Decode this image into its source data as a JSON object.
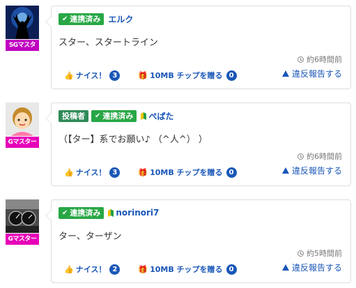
{
  "comments": [
    {
      "rank_label": "SGマスタ",
      "rank_color": "#c000c0",
      "avatar_icon": "deer-silhouette-icon",
      "tags": [
        {
          "label": "連携済み",
          "kind": "linked"
        }
      ],
      "beginner_mark": false,
      "username": "エルク",
      "text": "スター、スタートライン",
      "timestamp": "約6時間前",
      "like_label": "ナイス！",
      "like_count": "3",
      "tip_label": "10MB チップを贈る",
      "tip_count": "0",
      "report_label": "違反報告する"
    },
    {
      "rank_label": "Gマスター",
      "rank_color": "#e600b8",
      "avatar_icon": "cartoon-person-icon",
      "tags": [
        {
          "label": "投稿者",
          "kind": "poster"
        },
        {
          "label": "連携済み",
          "kind": "linked"
        }
      ],
      "beginner_mark": true,
      "username": "ぺぱた",
      "text": "（【ター】系でお願い♪ （^人^） ）",
      "timestamp": "約6時間前",
      "like_label": "ナイス！",
      "like_count": "3",
      "tip_label": "10MB チップを贈る",
      "tip_count": "0",
      "report_label": "違反報告する"
    },
    {
      "rank_label": "Gマスター",
      "rank_color": "#e600b8",
      "avatar_icon": "car-dashboard-icon",
      "tags": [
        {
          "label": "連携済み",
          "kind": "linked"
        }
      ],
      "beginner_mark": true,
      "username": "norinori7",
      "text": "ター、ターザン",
      "timestamp": "約5時間前",
      "like_label": "ナイス！",
      "like_count": "2",
      "tip_label": "10MB チップを贈る",
      "tip_count": "0",
      "report_label": "違反報告する"
    }
  ]
}
